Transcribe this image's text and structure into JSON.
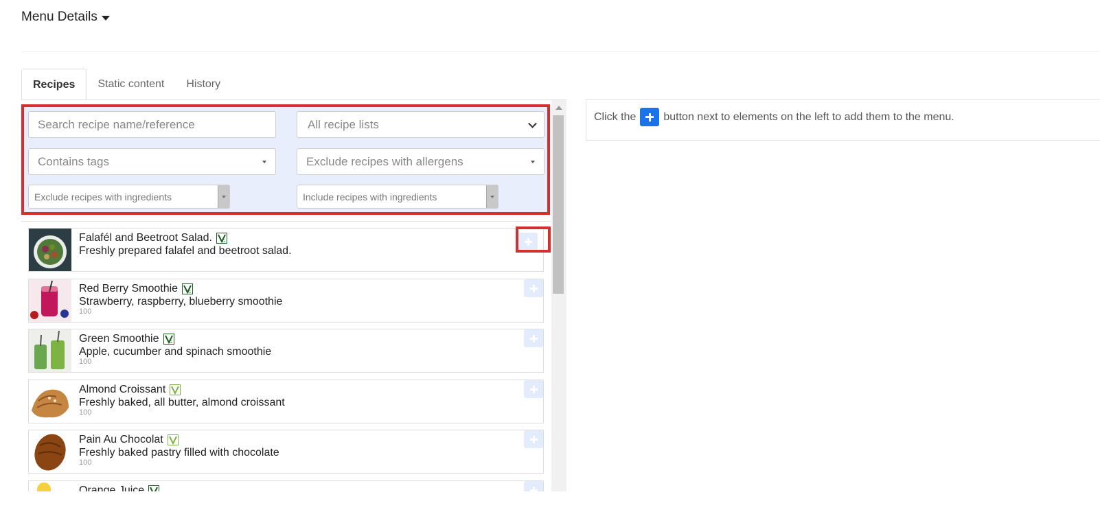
{
  "header": {
    "title": "Menu Details"
  },
  "tabs": [
    {
      "label": "Recipes",
      "active": true
    },
    {
      "label": "Static content",
      "active": false
    },
    {
      "label": "History",
      "active": false
    }
  ],
  "filters": {
    "search_placeholder": "Search recipe name/reference",
    "recipe_lists": "All recipe lists",
    "contains_tags": "Contains tags",
    "exclude_allergens": "Exclude recipes with allergens",
    "exclude_ingredients": "Exclude recipes with ingredients",
    "include_ingredients": "Include recipes with ingredients"
  },
  "recipes": [
    {
      "name": "Falafél and Beetroot Salad.",
      "description": "Freshly prepared falafel and beetroot salad.",
      "calories": "",
      "icon": "vegan-icon"
    },
    {
      "name": "Red Berry Smoothie",
      "description": "Strawberry, raspberry, blueberry smoothie",
      "calories": "100",
      "icon": "vegan-icon"
    },
    {
      "name": "Green Smoothie",
      "description": "Apple, cucumber and spinach smoothie",
      "calories": "100",
      "icon": "vegan-icon"
    },
    {
      "name": "Almond Croissant",
      "description": "Freshly baked, all butter, almond croissant",
      "calories": "100",
      "icon": "vegetarian-icon"
    },
    {
      "name": "Pain Au Chocolat",
      "description": "Freshly baked pastry filled with chocolate",
      "calories": "100",
      "icon": "vegetarian-icon"
    },
    {
      "name": "Orange Juice",
      "description": "",
      "calories": "",
      "icon": "vegan-icon"
    }
  ],
  "hint": {
    "before": "Click the",
    "after": "button next to elements on the left to add them to the menu."
  },
  "colors": {
    "accent": "#1a73e8",
    "highlight": "#d32f2f",
    "filter_bg": "#e8eefb"
  }
}
